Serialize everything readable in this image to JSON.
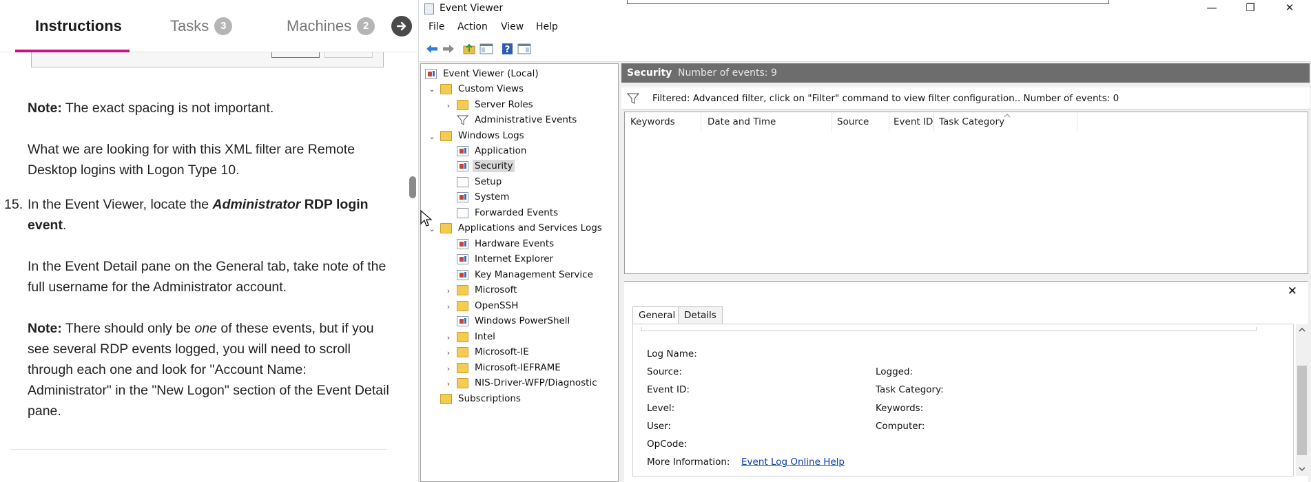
{
  "instructions": {
    "tabs": [
      {
        "label": "Instructions"
      },
      {
        "label": "Tasks",
        "badge": "3"
      },
      {
        "label": "Machines",
        "badge": "2"
      }
    ],
    "note1_bold": "Note:",
    "note1_text": " The exact spacing is not important.",
    "para1": "What we are looking for with this XML filter are Remote Desktop logins with Logon Type 10.",
    "step_number": "15.",
    "step_text_pre": "In the Event Viewer, locate the ",
    "step_text_em": "Administrator",
    "step_text_bold": " RDP login event",
    "step_text_post": ".",
    "para2": "In the Event Detail pane on the General tab, take note of the full username for the Administrator account.",
    "note2_bold": "Note:",
    "note2_pre": " There should only be ",
    "note2_em": "one",
    "note2_post": " of these events, but if you see several RDP events logged, you will need to scroll through each one and look for \"Account Name: Administrator\" in the \"New Logon\" section of the Event Detail pane."
  },
  "window": {
    "title": "Event Viewer",
    "controls": {
      "minimize": "—",
      "restore": "❐",
      "close": "✕"
    }
  },
  "menu": [
    "File",
    "Action",
    "View",
    "Help"
  ],
  "tree": {
    "root": "Event Viewer (Local)",
    "custom_views": "Custom Views",
    "server_roles": "Server Roles",
    "administrative_events": "Administrative Events",
    "windows_logs": "Windows Logs",
    "application": "Application",
    "security": "Security",
    "setup": "Setup",
    "system": "System",
    "forwarded_events": "Forwarded Events",
    "app_services_logs": "Applications and Services Logs",
    "hardware_events": "Hardware Events",
    "internet_explorer": "Internet Explorer",
    "key_management": "Key Management Service",
    "microsoft": "Microsoft",
    "openssh": "OpenSSH",
    "powershell": "Windows PowerShell",
    "intel": "Intel",
    "microsoft_ie": "Microsoft-IE",
    "microsoft_ieframe": "Microsoft-IEFRAME",
    "nis_driver": "NIS-Driver-WFP/Diagnostic",
    "subscriptions": "Subscriptions"
  },
  "log_header": {
    "name": "Security",
    "count": "Number of events: 9"
  },
  "filter_text": "Filtered: Advanced filter, click on \"Filter\" command to view filter configuration.. Number of events: 0",
  "columns": [
    "Keywords",
    "Date and Time",
    "Source",
    "Event ID",
    "Task Category"
  ],
  "detail": {
    "close": "✕",
    "tabs": [
      "General",
      "Details"
    ],
    "log_name": "Log Name:",
    "source": "Source:",
    "logged": "Logged:",
    "event_id": "Event ID:",
    "task_category": "Task Category:",
    "level": "Level:",
    "keywords": "Keywords:",
    "user": "User:",
    "computer": "Computer:",
    "opcode": "OpCode:",
    "more_info": "More Information:",
    "more_info_link": "Event Log Online Help"
  }
}
